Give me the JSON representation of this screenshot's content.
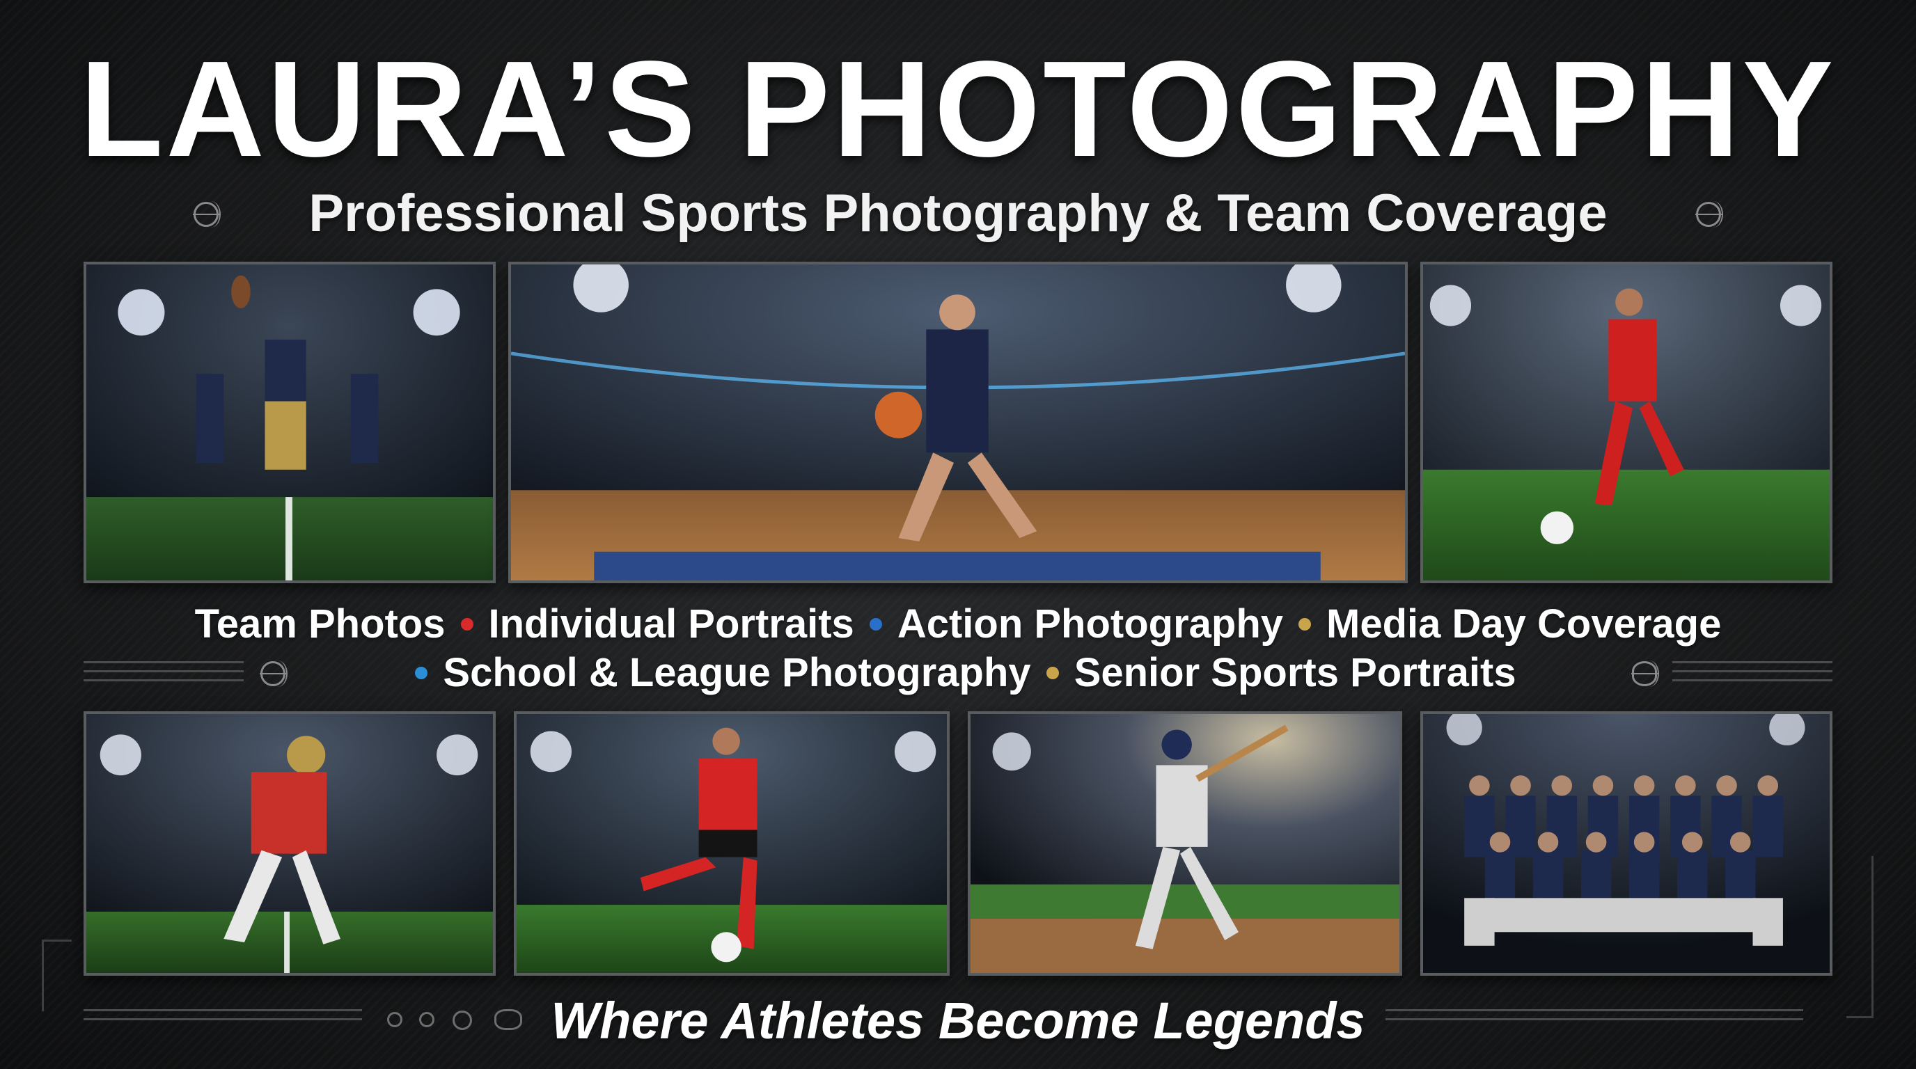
{
  "header": {
    "title": "LAURA’S PHOTOGRAPHY",
    "subtitle": "Professional Sports Photography & Team Coverage"
  },
  "services": {
    "line1": [
      {
        "label": "Team Photos",
        "dot_color": "#d92b2b"
      },
      {
        "label": "Individual Portraits",
        "dot_color": "#2a6fc9"
      },
      {
        "label": "Action Photography",
        "dot_color": "#c9a44a"
      },
      {
        "label": "Media Day Coverage",
        "dot_color": null
      }
    ],
    "line2": [
      {
        "label": "School & League Photography",
        "dot_color": "#2a8fd6"
      },
      {
        "label": "Senior Sports Portraits",
        "dot_color": "#c9a44a"
      }
    ]
  },
  "photos": [
    {
      "icon": "football-team-photo"
    },
    {
      "icon": "basketball-action-photo"
    },
    {
      "icon": "soccer-action-photo"
    },
    {
      "icon": "football-runner-photo"
    },
    {
      "icon": "soccer-kick-photo"
    },
    {
      "icon": "baseball-batter-photo"
    },
    {
      "icon": "team-group-photo"
    }
  ],
  "tagline": "Where Athletes Become Legends",
  "colors": {
    "background": "#151617",
    "frame": "#5a5d60",
    "accent_red": "#d92b2b",
    "accent_blue": "#2a6fc9",
    "accent_gold": "#c9a44a"
  }
}
